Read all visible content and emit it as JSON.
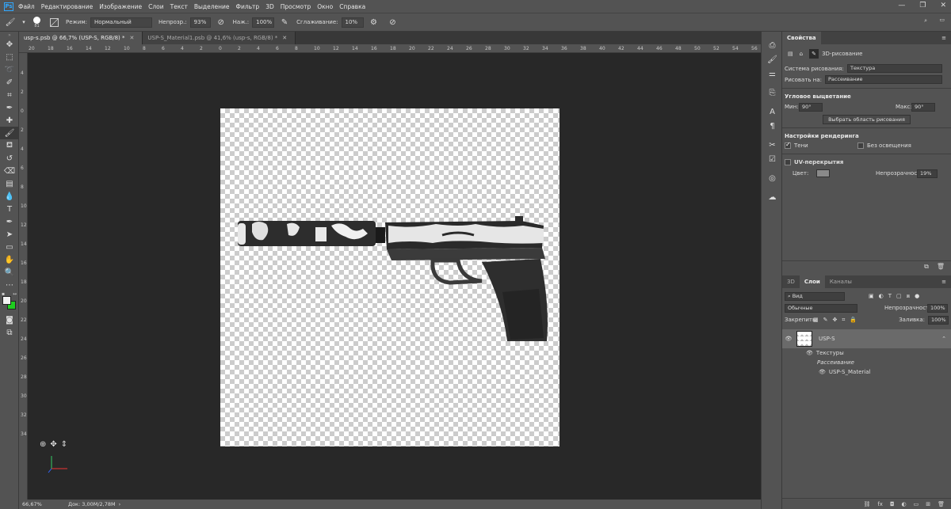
{
  "menu": {
    "logo": "Ps",
    "items": [
      "Файл",
      "Редактирование",
      "Изображение",
      "Слои",
      "Текст",
      "Выделение",
      "Фильтр",
      "3D",
      "Просмотр",
      "Окно",
      "Справка"
    ]
  },
  "options": {
    "brush_size": "81",
    "mode_label": "Режим:",
    "mode_value": "Нормальный",
    "opacity_label": "Непрозр.:",
    "opacity_value": "93%",
    "flow_label": "Наж.:",
    "flow_value": "100%",
    "smoothing_label": "Сглаживание:",
    "smoothing_value": "10%"
  },
  "tabs": [
    {
      "label": "usp-s.psb @ 66,7% (USP-S, RGB/8) *",
      "active": true
    },
    {
      "label": "USP-S_Material1.psb @ 41,6% (usp-s, RGB/8) *",
      "active": false
    }
  ],
  "ruler_h": [
    "20",
    "18",
    "16",
    "14",
    "12",
    "10",
    "8",
    "6",
    "4",
    "2",
    "0",
    "2",
    "4",
    "6",
    "8",
    "10",
    "12",
    "14",
    "16",
    "18",
    "20",
    "22",
    "24",
    "26",
    "28",
    "30",
    "32",
    "34",
    "36",
    "38",
    "40",
    "42",
    "44",
    "46",
    "48",
    "50",
    "52",
    "54",
    "56"
  ],
  "ruler_v": [
    "4",
    "2",
    "0",
    "2",
    "4",
    "6",
    "8",
    "10",
    "12",
    "14",
    "16",
    "18",
    "20",
    "22",
    "24",
    "26",
    "28",
    "30",
    "32",
    "34"
  ],
  "status": {
    "zoom": "66,67%",
    "doc": "Док: 3,00M/2,78M"
  },
  "properties": {
    "tab": "Свойства",
    "mode": "3D-рисование",
    "paint_system_label": "Система рисования:",
    "paint_system_value": "Текстура",
    "paint_on_label": "Рисовать на:",
    "paint_on_value": "Рассеивание",
    "angle_header": "Угловое выцветание",
    "min_label": "Мин:",
    "min_value": "90°",
    "max_label": "Макс:",
    "max_value": "90°",
    "select_area_button": "Выбрать область рисования",
    "render_header": "Настройки рендеринга",
    "shadows_label": "Тени",
    "no_lighting_label": "Без освещения",
    "uv_label": "UV-перекрытия",
    "color_label": "Цвет:",
    "opacity_label": "Непрозрачность:",
    "opacity_value": "19%"
  },
  "layers": {
    "tabs": [
      "3D",
      "Слои",
      "Каналы"
    ],
    "active_tab": "Слои",
    "filter_value": "Вид",
    "blend_value": "Обычные",
    "opacity_label": "Непрозрачность:",
    "opacity_value": "100%",
    "lock_label": "Закрепить:",
    "fill_label": "Заливка:",
    "fill_value": "100%",
    "layer_name": "USP-S",
    "textures_label": "Текстуры",
    "diffuse_label": "Рассеивание",
    "material_label": "USP-S_Material"
  },
  "colors": {
    "accent": "#31a8ff",
    "background_swatch": "#1fcc1f"
  }
}
